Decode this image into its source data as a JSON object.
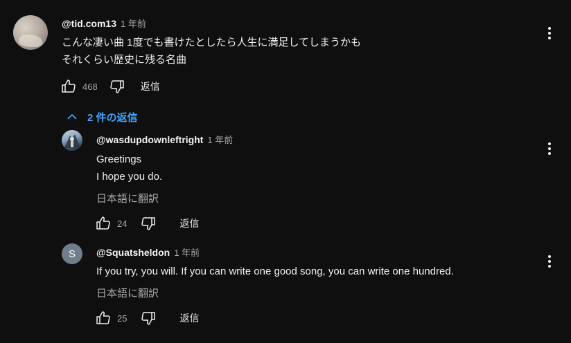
{
  "comment": {
    "handle": "@tid.com13",
    "time": "1 年前",
    "lines": [
      "こんな凄い曲 1度でも書けたとしたら人生に満足してしまうかも",
      "それくらい歴史に残る名曲"
    ],
    "likes": "468",
    "reply_label": "返信"
  },
  "replies_toggle": {
    "label": "2 件の返信"
  },
  "replies": [
    {
      "handle": "@wasdupdownleftright",
      "time": "1 年前",
      "lines": [
        "Greetings",
        "I hope you do."
      ],
      "translate": "日本語に翻訳",
      "likes": "24",
      "reply_label": "返信"
    },
    {
      "avatar_letter": "S",
      "handle": "@Squatsheldon",
      "time": "1 年前",
      "lines": [
        "If you try, you will. If you can write one good song, you can write one hundred."
      ],
      "translate": "日本語に翻訳",
      "likes": "25",
      "reply_label": "返信"
    }
  ],
  "colors": {
    "background": "#0f0f0f",
    "link": "#3ea6ff",
    "muted": "#aaaaaa",
    "text": "#f1f1f1"
  },
  "icons": [
    "thumb-up-icon",
    "thumb-down-icon",
    "more-vert-icon",
    "chevron-up-icon"
  ]
}
